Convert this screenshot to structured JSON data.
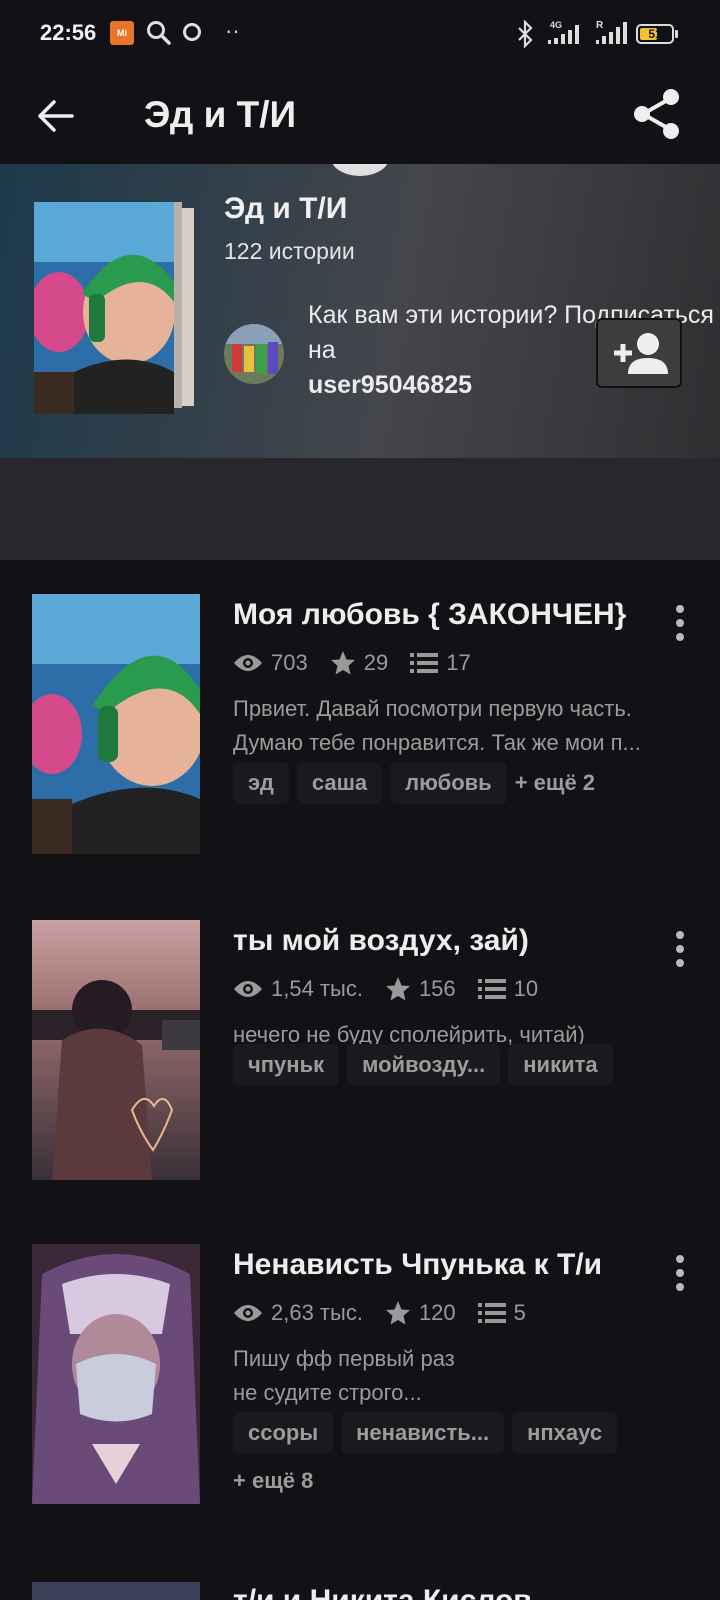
{
  "status_bar": {
    "time": "22:56",
    "mi_label": "Mi",
    "network": "4G",
    "roaming": "R",
    "battery": "51",
    "icons": [
      "mi-app-icon",
      "search-icon",
      "chrome-icon",
      "more-dots-icon",
      "bluetooth-icon",
      "signal-4g-icon",
      "signal-r-icon",
      "battery-icon"
    ]
  },
  "app_bar": {
    "title": "Эд и Т/И",
    "back_icon": "arrow-left-icon",
    "share_icon": "share-icon"
  },
  "header": {
    "title": "Эд и Т/И",
    "count": "122 истории",
    "follow_prompt": "Как вам эти истории? Подписаться на",
    "username": "user95046825",
    "follow_icon": "add-person-icon"
  },
  "stories": [
    {
      "title": "Моя любовь { ЗАКОНЧЕН}",
      "views": "703",
      "votes": "29",
      "parts": "17",
      "description_lines": [
        "Првиет. Давай посмотри первую часть.",
        "Думаю тебе понравится. Так же мои п..."
      ],
      "tags": [
        "эд",
        "саша",
        "любовь"
      ],
      "more": "+ ещё 2"
    },
    {
      "title": "ты мой воздух, зай)",
      "views": "1,54 тыс.",
      "votes": "156",
      "parts": "10",
      "description_lines": [
        "нечего не буду сполейрить, читай)"
      ],
      "tags": [
        "чпуньк",
        "мойвозду...",
        "никита"
      ]
    },
    {
      "title": "Ненависть Чпунька к Т/и",
      "views": "2,63 тыс.",
      "votes": "120",
      "parts": "5",
      "description_lines": [
        "Пишу фф первый раз",
        "не судите строго..."
      ],
      "tags": [
        "ссоры",
        "ненависть...",
        "нпхаус"
      ],
      "more": "+ ещё 8"
    },
    {
      "title": "т/и и Никита Кислов"
    }
  ],
  "colors": {
    "background": "#121115",
    "text_primary": "#ededed",
    "text_secondary": "#9a9a9a",
    "banner_band": "#28272b"
  }
}
